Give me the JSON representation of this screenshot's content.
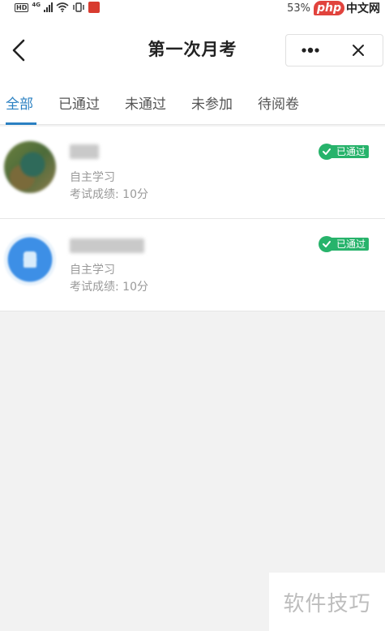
{
  "status_bar": {
    "hd": "HD",
    "network": "4G",
    "battery": "53%",
    "php_logo": "php",
    "site": "中文网"
  },
  "header": {
    "title": "第一次月考",
    "back_icon": "chevron-left-icon",
    "more_icon": "more-dots-icon",
    "close_icon": "close-icon"
  },
  "tabs": [
    {
      "label": "全部",
      "active": true
    },
    {
      "label": "已通过",
      "active": false
    },
    {
      "label": "未通过",
      "active": false
    },
    {
      "label": "未参加",
      "active": false
    },
    {
      "label": "待阅卷",
      "active": false
    }
  ],
  "items": [
    {
      "study_type": "自主学习",
      "score": "考试成绩: 10分",
      "status": "已通过"
    },
    {
      "study_type": "自主学习",
      "score": "考试成绩: 10分",
      "status": "已通过"
    }
  ],
  "colors": {
    "accent": "#2a80c2",
    "status_pass": "#27b36b",
    "background": "#f2f2f2"
  },
  "watermark": "软件技巧"
}
